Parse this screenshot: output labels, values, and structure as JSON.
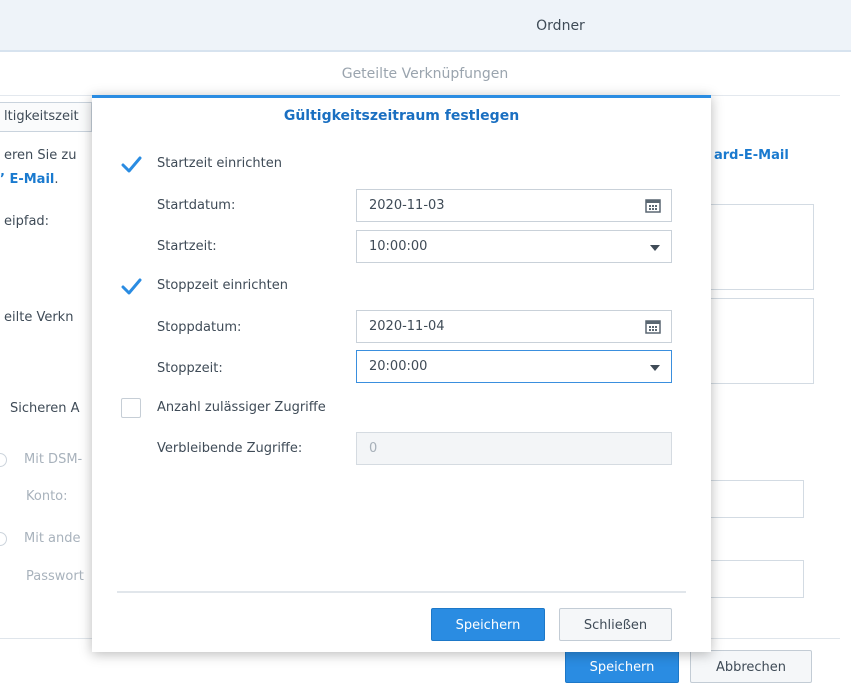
{
  "window": {
    "title": "Ordner"
  },
  "background": {
    "header": "Geteilte Verknüpfungen",
    "tab_label": "ltigkeitszeit",
    "desc_line1": "eren Sie zu",
    "desc_link_right": "ard-E-Mail",
    "desc_line2_link": "E-Mail",
    "desc_line2_suffix": ".",
    "path_label": "eipfad:",
    "shared_label": "eilte Verkn",
    "secure_label": "Sicheren A",
    "radio1_label": "Mit DSM-",
    "konto_label": "Konto:",
    "radio2_label": "Mit ande",
    "password_label": "Passwort",
    "save_label": "Speichern",
    "cancel_label": "Abbrechen"
  },
  "modal": {
    "title": "Gültigkeitszeitraum festlegen",
    "start": {
      "checkbox_label": "Startzeit einrichten",
      "checked": true,
      "date_label": "Startdatum:",
      "date_value": "2020-11-03",
      "time_label": "Startzeit:",
      "time_value": "10:00:00"
    },
    "stop": {
      "checkbox_label": "Stoppzeit einrichten",
      "checked": true,
      "date_label": "Stoppdatum:",
      "date_value": "2020-11-04",
      "time_label": "Stoppzeit:",
      "time_value": "20:00:00"
    },
    "access": {
      "checkbox_label": "Anzahl zulässiger Zugriffe",
      "checked": false,
      "remaining_label": "Verbleibende Zugriffe:",
      "remaining_value": "0"
    },
    "save_label": "Speichern",
    "close_label": "Schließen"
  },
  "colors": {
    "accent": "#2a8ce2",
    "title_blue": "#1a6fc1",
    "link_blue": "#1a7acf"
  },
  "icons": {
    "checkmark": "checkmark-icon",
    "calendar": "calendar-icon",
    "dropdown": "chevron-down-icon"
  }
}
